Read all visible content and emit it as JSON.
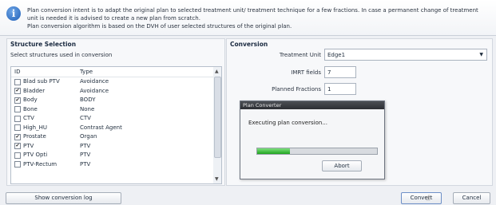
{
  "info": {
    "icon": "info-icon",
    "lines": [
      "Plan conversion intent is to adapt the original plan to selected treatment unit/ treatment technique for a few fractions. In case a permanent change of treatment",
      "unit is needed it is advised to create a new plan from scratch.",
      "Plan conversion algorithm is based on the DVH of user selected structures of the original plan."
    ]
  },
  "structure_selection": {
    "title": "Structure Selection",
    "subtitle": "Select structures used in conversion",
    "columns": [
      "ID",
      "Type"
    ],
    "rows": [
      {
        "id": "Blad sub PTV",
        "type": "Avoidance",
        "checked": false
      },
      {
        "id": "Bladder",
        "type": "Avoidance",
        "checked": true
      },
      {
        "id": "Body",
        "type": "BODY",
        "checked": true
      },
      {
        "id": "Bone",
        "type": "None",
        "checked": false
      },
      {
        "id": "CTV",
        "type": "CTV",
        "checked": false
      },
      {
        "id": "High_HU",
        "type": "Contrast Agent",
        "checked": false
      },
      {
        "id": "Prostate",
        "type": "Organ",
        "checked": true
      },
      {
        "id": "PTV",
        "type": "PTV",
        "checked": true
      },
      {
        "id": "PTV Opti",
        "type": "PTV",
        "checked": false
      },
      {
        "id": "PTV-Rectum",
        "type": "PTV",
        "checked": false
      }
    ]
  },
  "conversion": {
    "title": "Conversion",
    "treatment_unit_label": "Treatment Unit",
    "treatment_unit_value": "Edge1",
    "imrt_fields_label": "IMRT fields",
    "imrt_fields_value": "7",
    "planned_fractions_label": "Planned Fractions",
    "planned_fractions_value": "1"
  },
  "dialog": {
    "title": "Plan Converter",
    "message": "Executing plan conversion...",
    "progress": 0.27,
    "abort_label": "Abort"
  },
  "buttons": {
    "show_log": "Show conversion log",
    "convert": "Convert",
    "cancel": "Cancel"
  },
  "colors": {
    "progress": "#2db52d",
    "info_icon": "#1f5fb7"
  }
}
